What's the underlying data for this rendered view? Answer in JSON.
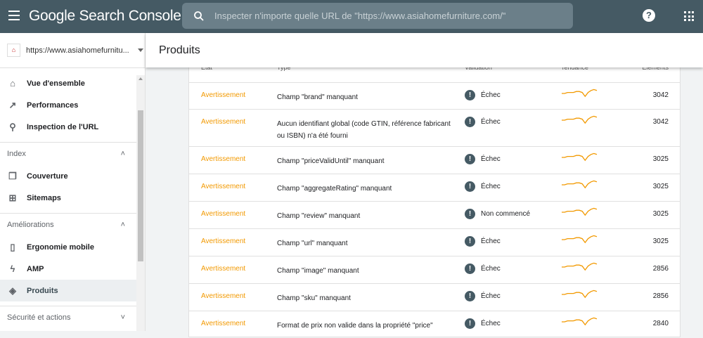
{
  "topbar": {
    "logo": "Google Search Console",
    "search_placeholder": "Inspecter n'importe quelle URL de \"https://www.asiahomefurniture.com/\"",
    "help": "?"
  },
  "sidebar": {
    "property": "https://www.asiahomefurnitu...",
    "favicon": "AHF",
    "items_top": [
      {
        "label": "Vue d'ensemble",
        "icon": "home-icon"
      },
      {
        "label": "Performances",
        "icon": "trending-up-icon"
      },
      {
        "label": "Inspection de l'URL",
        "icon": "search-icon"
      }
    ],
    "index": {
      "label": "Index",
      "items": [
        {
          "label": "Couverture",
          "icon": "copy-icon"
        },
        {
          "label": "Sitemaps",
          "icon": "sitemap-icon"
        }
      ]
    },
    "ameliorations": {
      "label": "Améliorations",
      "items": [
        {
          "label": "Ergonomie mobile",
          "icon": "phone-icon"
        },
        {
          "label": "AMP",
          "icon": "bolt-icon"
        },
        {
          "label": "Produits",
          "icon": "layers-icon"
        }
      ]
    },
    "securite": {
      "label": "Sécurité et actions"
    }
  },
  "page": {
    "title": "Produits"
  },
  "table": {
    "headers": [
      "État",
      "Type",
      "Validation",
      "Tendance",
      "Éléments"
    ],
    "rows": [
      {
        "status": "Avertissement",
        "type": "Champ \"brand\" manquant",
        "validation": "Échec",
        "count": "3042",
        "trend": [
          5,
          5,
          6,
          6,
          6,
          7,
          7,
          6,
          2,
          6,
          8,
          9,
          8
        ]
      },
      {
        "status": "Avertissement",
        "type": "Aucun identifiant global (code GTIN, référence fabricant ou ISBN) n'a été fourni",
        "validation": "Échec",
        "count": "3042",
        "trend": [
          5,
          5,
          6,
          6,
          6,
          7,
          7,
          6,
          2,
          6,
          8,
          9,
          8
        ]
      },
      {
        "status": "Avertissement",
        "type": "Champ \"priceValidUntil\" manquant",
        "validation": "Échec",
        "count": "3025",
        "trend": [
          5,
          5,
          6,
          6,
          6,
          7,
          7,
          6,
          2,
          6,
          8,
          9,
          8
        ]
      },
      {
        "status": "Avertissement",
        "type": "Champ \"aggregateRating\" manquant",
        "validation": "Échec",
        "count": "3025",
        "trend": [
          5,
          5,
          6,
          6,
          6,
          7,
          7,
          6,
          2,
          6,
          8,
          9,
          8
        ]
      },
      {
        "status": "Avertissement",
        "type": "Champ \"review\" manquant",
        "validation": "Non commencé",
        "count": "3025",
        "trend": [
          5,
          5,
          6,
          6,
          6,
          7,
          7,
          6,
          2,
          6,
          8,
          9,
          8
        ]
      },
      {
        "status": "Avertissement",
        "type": "Champ \"url\" manquant",
        "validation": "Échec",
        "count": "3025",
        "trend": [
          5,
          5,
          6,
          6,
          6,
          7,
          7,
          6,
          2,
          6,
          8,
          9,
          8
        ]
      },
      {
        "status": "Avertissement",
        "type": "Champ \"image\" manquant",
        "validation": "Échec",
        "count": "2856",
        "trend": [
          5,
          5,
          6,
          6,
          6,
          7,
          7,
          6,
          2,
          6,
          8,
          9,
          8
        ]
      },
      {
        "status": "Avertissement",
        "type": "Champ \"sku\" manquant",
        "validation": "Échec",
        "count": "2856",
        "trend": [
          5,
          5,
          6,
          6,
          6,
          7,
          7,
          6,
          2,
          6,
          8,
          9,
          8
        ]
      },
      {
        "status": "Avertissement",
        "type": "Format de prix non valide dans la propriété \"price\"",
        "validation": "Échec",
        "count": "2840",
        "trend": [
          5,
          5,
          6,
          6,
          6,
          7,
          7,
          6,
          2,
          6,
          8,
          9,
          8
        ]
      }
    ]
  },
  "colors": {
    "topbar": "#455a64",
    "warning": "#f29900"
  }
}
